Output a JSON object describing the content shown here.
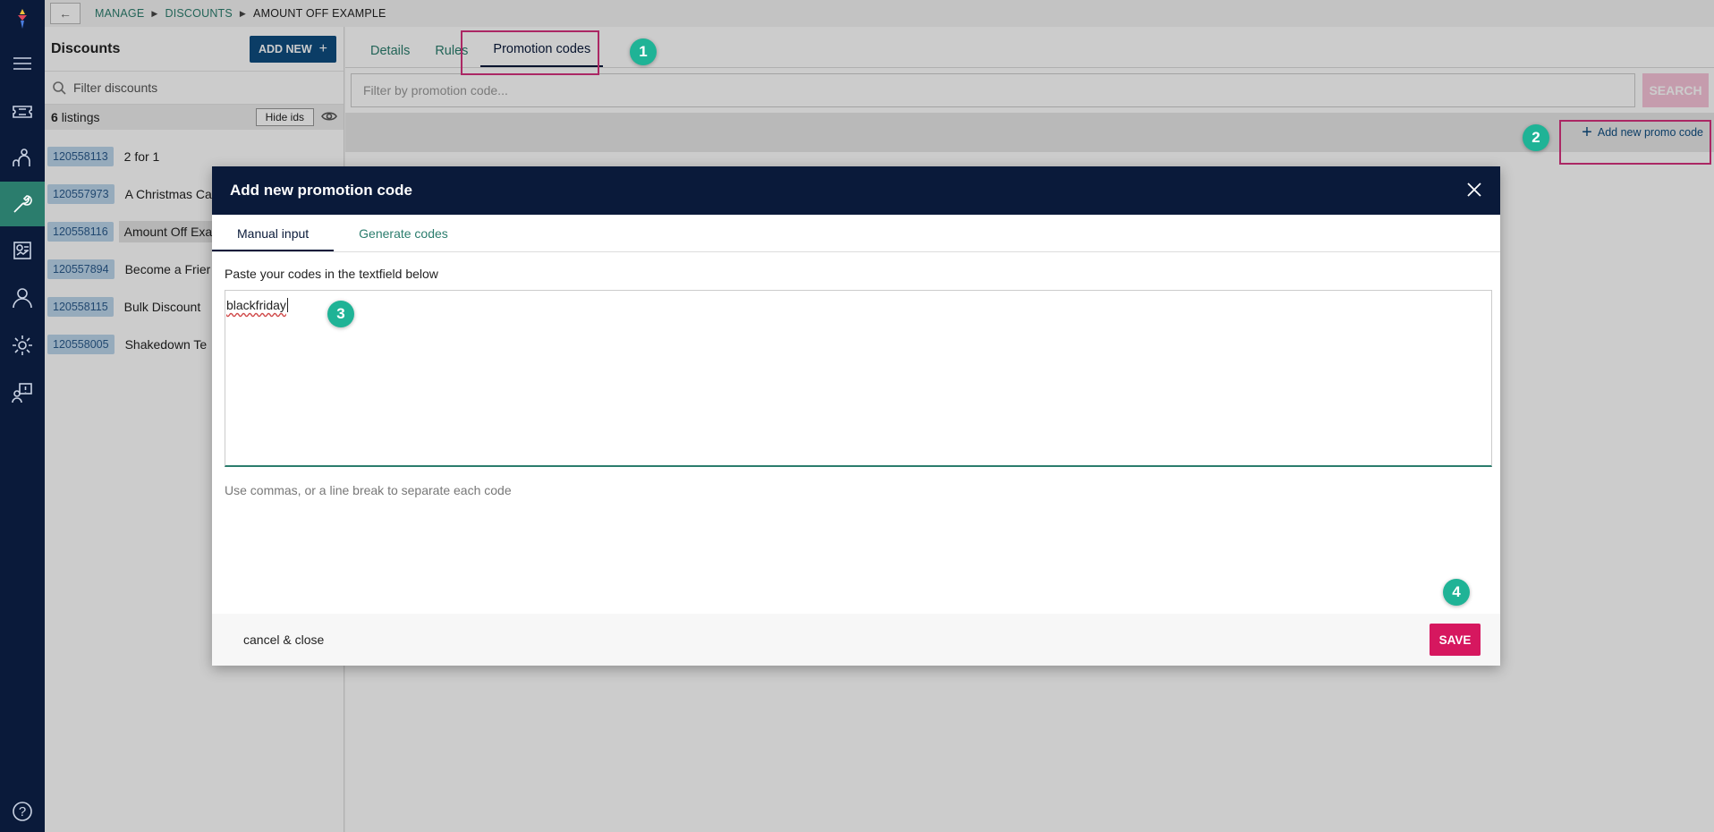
{
  "breadcrumb": {
    "manage": "MANAGE",
    "discounts": "DISCOUNTS",
    "current": "AMOUNT OFF EXAMPLE"
  },
  "list": {
    "title": "Discounts",
    "add_new_label": "ADD NEW",
    "filter_placeholder": "Filter discounts",
    "count": "6",
    "count_suffix": "listings",
    "hide_ids_label": "Hide ids",
    "items": [
      {
        "id": "120558113",
        "name": "2 for 1"
      },
      {
        "id": "120557973",
        "name": "A Christmas Ca"
      },
      {
        "id": "120558116",
        "name": "Amount Off Exa"
      },
      {
        "id": "120557894",
        "name": "Become a Frier"
      },
      {
        "id": "120558115",
        "name": "Bulk Discount"
      },
      {
        "id": "120558005",
        "name": "Shakedown Te"
      }
    ]
  },
  "tabs": {
    "details": "Details",
    "rules": "Rules",
    "promotion_codes": "Promotion codes"
  },
  "search": {
    "placeholder": "Filter by promotion code...",
    "button": "SEARCH"
  },
  "add_promo_label": "Add new promo code",
  "modal": {
    "title": "Add new promotion code",
    "tab_manual": "Manual input",
    "tab_generate": "Generate codes",
    "instruction": "Paste your codes in the textfield below",
    "codes_value": "blackfriday",
    "helper": "Use commas, or a line break to separate each code",
    "cancel_label": "cancel & close",
    "save_label": "SAVE"
  },
  "steps": [
    "1",
    "2",
    "3",
    "4"
  ],
  "colors": {
    "rail": "#0a1a3a",
    "accent_teal": "#2b7d6d",
    "primary_blue": "#0e4d80",
    "save_pink": "#d6175f",
    "highlight_pink": "#d6317e",
    "step_green": "#1fb396"
  },
  "help_glyph": "?"
}
